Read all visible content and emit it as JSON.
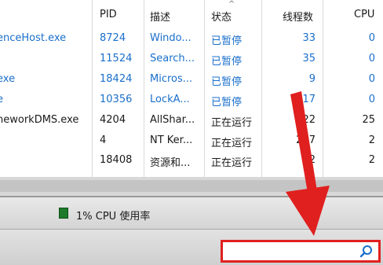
{
  "columns": {
    "pid": "PID",
    "desc": "描述",
    "status": "状态",
    "threads": "线程数",
    "cpu": "CPU"
  },
  "rows": [
    {
      "name": "enceHost.exe",
      "pid": "8724",
      "desc": "Windo...",
      "status": "已暂停",
      "threads": "33",
      "cpu": "0",
      "suspended": true
    },
    {
      "name": "",
      "pid": "11524",
      "desc": "Search...",
      "status": "已暂停",
      "threads": "35",
      "cpu": "0",
      "suspended": true
    },
    {
      "name": "exe",
      "pid": "18424",
      "desc": "Micros...",
      "status": "已暂停",
      "threads": "9",
      "cpu": "0",
      "suspended": true
    },
    {
      "name": "e",
      "pid": "10356",
      "desc": "LockA...",
      "status": "已暂停",
      "threads": "17",
      "cpu": "0",
      "suspended": true
    },
    {
      "name": "neworkDMS.exe",
      "pid": "4204",
      "desc": "AllShar...",
      "status": "正在运行",
      "threads": "22",
      "cpu": "25",
      "suspended": false
    },
    {
      "name": "",
      "pid": "4",
      "desc": "NT Ker...",
      "status": "正在运行",
      "threads": "207",
      "cpu": "2",
      "suspended": false
    },
    {
      "name": "",
      "pid": "18408",
      "desc": "资源和...",
      "status": "正在运行",
      "threads": "22",
      "cpu": "2",
      "suspended": false
    }
  ],
  "status_bar": {
    "cpu_usage": "1% CPU 使用率"
  },
  "search": {
    "value": "",
    "placeholder": ""
  },
  "colors": {
    "suspended_text": "#1a6fcb",
    "highlight": "#e0201f",
    "cpu_indicator": "#1d7a2a"
  }
}
